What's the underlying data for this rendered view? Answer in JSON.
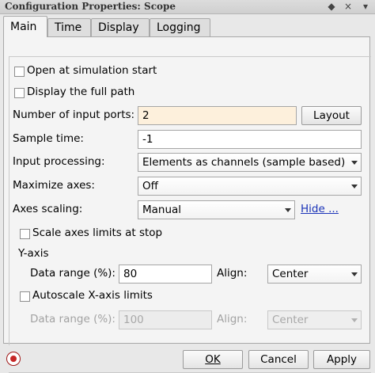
{
  "window": {
    "title": "Configuration Properties: Scope",
    "close_glyph": "×"
  },
  "tabs": [
    {
      "label": "Main",
      "active": true
    },
    {
      "label": "Time",
      "active": false
    },
    {
      "label": "Display",
      "active": false
    },
    {
      "label": "Logging",
      "active": false
    }
  ],
  "main": {
    "open_at_start": {
      "label": "Open at simulation start",
      "checked": false
    },
    "display_full_path": {
      "label": "Display the full path",
      "checked": false
    },
    "num_input_ports": {
      "label": "Number of input ports:",
      "value": "2"
    },
    "layout_button": "Layout",
    "sample_time": {
      "label": "Sample time:",
      "value": "-1"
    },
    "input_processing": {
      "label": "Input processing:",
      "selected": "Elements as channels (sample based)"
    },
    "maximize_axes": {
      "label": "Maximize axes:",
      "selected": "Off"
    },
    "axes_scaling": {
      "label": "Axes scaling:",
      "selected": "Manual",
      "link": "Hide ..."
    },
    "scale_limits_at_stop": {
      "label": "Scale axes limits at stop",
      "checked": false
    },
    "y_axis": {
      "heading": "Y-axis",
      "data_range_label": "Data range (%):",
      "data_range_value": "80",
      "align_label": "Align:",
      "align_selected": "Center"
    },
    "autoscale_x": {
      "label": "Autoscale X-axis limits",
      "checked": false
    },
    "x_axis": {
      "data_range_label": "Data range (%):",
      "data_range_value": "100",
      "align_label": "Align:",
      "align_selected": "Center"
    }
  },
  "buttons": {
    "ok": "OK",
    "cancel": "Cancel",
    "apply": "Apply"
  },
  "icons": {
    "help": "help-icon"
  },
  "colors": {
    "link": "#1a33b8",
    "focused_field": "#fdf0dc",
    "help_red": "#c62828"
  }
}
